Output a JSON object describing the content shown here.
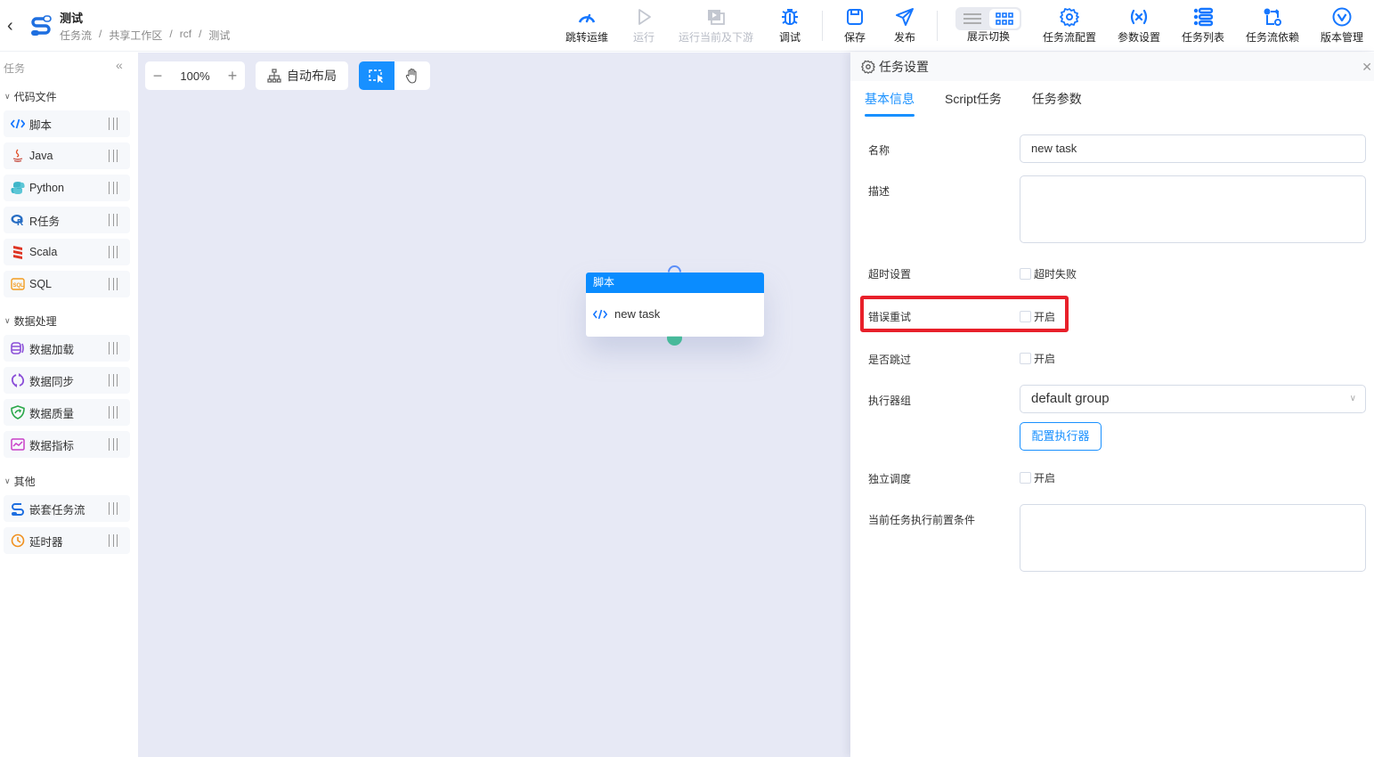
{
  "header": {
    "title": "测试",
    "breadcrumb": [
      "任务流",
      "/",
      "共享工作区",
      "/",
      "rcf",
      "/",
      "测试"
    ],
    "toolbar": [
      {
        "id": "ops",
        "label": "跳转运维",
        "icon": "gauge-icon",
        "disabled": false
      },
      {
        "id": "run",
        "label": "运行",
        "icon": "play-icon",
        "disabled": true
      },
      {
        "id": "run-downstream",
        "label": "运行当前及下游",
        "icon": "play-stack-icon",
        "disabled": true
      },
      {
        "id": "debug",
        "label": "调试",
        "icon": "bug-icon",
        "disabled": false
      },
      {
        "id": "save",
        "label": "保存",
        "icon": "save-icon",
        "disabled": false
      },
      {
        "id": "publish",
        "label": "发布",
        "icon": "send-icon",
        "disabled": false
      },
      {
        "id": "display-switch",
        "label": "展示切换",
        "icon": "view-switch-icon",
        "disabled": false
      },
      {
        "id": "flow-config",
        "label": "任务流配置",
        "icon": "gear-icon",
        "disabled": false
      },
      {
        "id": "params",
        "label": "参数设置",
        "icon": "variable-icon",
        "disabled": false
      },
      {
        "id": "task-list",
        "label": "任务列表",
        "icon": "list-icon",
        "disabled": false
      },
      {
        "id": "flow-deps",
        "label": "任务流依赖",
        "icon": "dependency-icon",
        "disabled": false
      },
      {
        "id": "versions",
        "label": "版本管理",
        "icon": "version-icon",
        "disabled": false
      }
    ],
    "display_switch_active": "grid"
  },
  "sidebar": {
    "heading": "任务",
    "groups": [
      {
        "label": "代码文件",
        "items": [
          {
            "label": "脚本",
            "icon": "code-icon"
          },
          {
            "label": "Java",
            "icon": "java-icon"
          },
          {
            "label": "Python",
            "icon": "python-icon"
          },
          {
            "label": "R任务",
            "icon": "r-icon"
          },
          {
            "label": "Scala",
            "icon": "scala-icon"
          },
          {
            "label": "SQL",
            "icon": "sql-icon"
          }
        ]
      },
      {
        "label": "数据处理",
        "items": [
          {
            "label": "数据加载",
            "icon": "database-load-icon"
          },
          {
            "label": "数据同步",
            "icon": "sync-icon"
          },
          {
            "label": "数据质量",
            "icon": "shield-check-icon"
          },
          {
            "label": "数据指标",
            "icon": "chart-trend-icon"
          }
        ]
      },
      {
        "label": "其他",
        "items": [
          {
            "label": "嵌套任务流",
            "icon": "nested-flow-icon"
          },
          {
            "label": "延时器",
            "icon": "clock-icon"
          }
        ]
      }
    ]
  },
  "canvas": {
    "zoom": "100%",
    "auto_layout": "自动布局",
    "active_mode": "select",
    "node": {
      "type": "脚本",
      "name": "new task"
    }
  },
  "panel": {
    "title": "任务设置",
    "tabs": [
      {
        "label": "基本信息",
        "active": true
      },
      {
        "label": "Script任务",
        "active": false
      },
      {
        "label": "任务参数",
        "active": false
      }
    ],
    "fields": {
      "name_label": "名称",
      "name_value": "new task",
      "desc_label": "描述",
      "desc_value": "",
      "timeout_label": "超时设置",
      "timeout_option": "超时失败",
      "timeout_checked": false,
      "retry_label": "错误重试",
      "retry_option": "开启",
      "retry_checked": false,
      "skip_label": "是否跳过",
      "skip_option": "开启",
      "skip_checked": false,
      "executor_label": "执行器组",
      "executor_value": "default group",
      "config_executor": "配置执行器",
      "independent_label": "独立调度",
      "independent_option": "开启",
      "independent_checked": false,
      "precondition_label": "当前任务执行前置条件",
      "precondition_value": ""
    },
    "highlight_color": "#e8202a"
  },
  "colors": {
    "accent": "#1890ff",
    "canvas_bg": "#e7e9f5",
    "node_header": "#0a8cff",
    "port_out": "#47b99a"
  }
}
